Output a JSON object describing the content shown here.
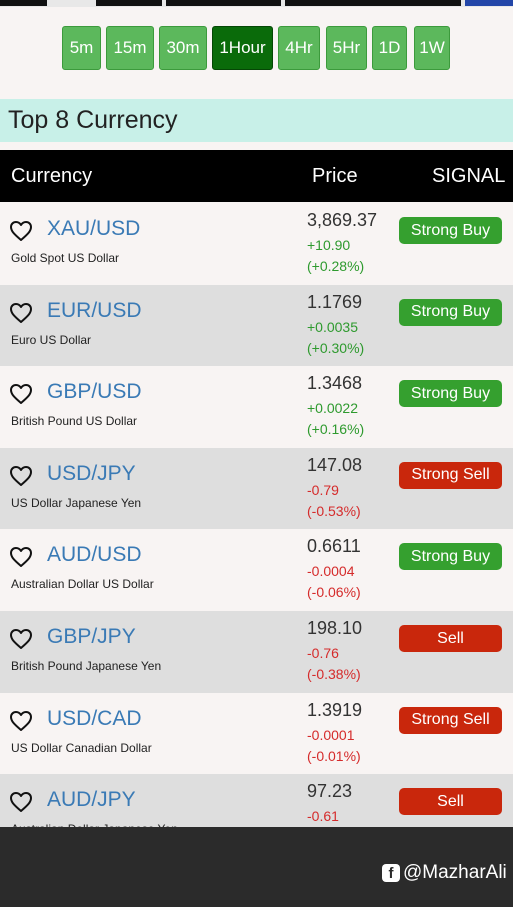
{
  "timeframes": [
    {
      "label": "5m",
      "active": false
    },
    {
      "label": "15m",
      "active": false
    },
    {
      "label": "30m",
      "active": false
    },
    {
      "label": "1Hour",
      "active": true
    },
    {
      "label": "4Hr",
      "active": false
    },
    {
      "label": "5Hr",
      "active": false
    },
    {
      "label": "1D",
      "active": false
    },
    {
      "label": "1W",
      "active": false
    }
  ],
  "section_title": "Top 8 Currency",
  "table": {
    "headers": {
      "currency": "Currency",
      "price": "Price",
      "signal": "SIGNAL"
    },
    "rows": [
      {
        "pair": "XAU/USD",
        "name": "Gold Spot US Dollar",
        "price": "3,869.37",
        "change": "+10.90",
        "percent": "(+0.28%)",
        "direction": "up",
        "signal": "Strong Buy",
        "signal_type": "buy"
      },
      {
        "pair": "EUR/USD",
        "name": "Euro US Dollar",
        "price": "1.1769",
        "change": "+0.0035",
        "percent": "(+0.30%)",
        "direction": "up",
        "signal": "Strong Buy",
        "signal_type": "buy"
      },
      {
        "pair": "GBP/USD",
        "name": "British Pound US Dollar",
        "price": "1.3468",
        "change": "+0.0022",
        "percent": "(+0.16%)",
        "direction": "up",
        "signal": "Strong Buy",
        "signal_type": "buy"
      },
      {
        "pair": "USD/JPY",
        "name": "US Dollar Japanese Yen",
        "price": "147.08",
        "change": "-0.79",
        "percent": "(-0.53%)",
        "direction": "down",
        "signal": "Strong Sell",
        "signal_type": "sell"
      },
      {
        "pair": "AUD/USD",
        "name": "Australian Dollar US Dollar",
        "price": "0.6611",
        "change": "-0.0004",
        "percent": "(-0.06%)",
        "direction": "down",
        "signal": "Strong Buy",
        "signal_type": "buy"
      },
      {
        "pair": "GBP/JPY",
        "name": "British Pound Japanese Yen",
        "price": "198.10",
        "change": "-0.76",
        "percent": "(-0.38%)",
        "direction": "down",
        "signal": "Sell",
        "signal_type": "sell"
      },
      {
        "pair": "USD/CAD",
        "name": "US Dollar Canadian Dollar",
        "price": "1.3919",
        "change": "-0.0001",
        "percent": "(-0.01%)",
        "direction": "down",
        "signal": "Strong Sell",
        "signal_type": "sell"
      },
      {
        "pair": "AUD/JPY",
        "name": "Australian Dollar Japanese Yen",
        "price": "97.23",
        "change": "-0.61",
        "percent": "",
        "direction": "down",
        "signal": "Sell",
        "signal_type": "sell"
      }
    ]
  },
  "watermark": {
    "icon": "facebook-icon",
    "text": "@MazharAli"
  },
  "colors": {
    "buy": "#35a02f",
    "sell": "#c9270c",
    "up": "#2e9a2e",
    "down": "#d52b2b",
    "pair": "#3a7ab5",
    "active_timeframe": "#0a6b0a",
    "timeframe": "#5cb85c"
  }
}
